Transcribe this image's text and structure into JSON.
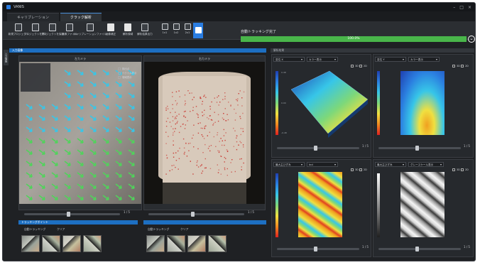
{
  "window": {
    "title": "VANIS"
  },
  "tabs": [
    {
      "label": "キャリブレーション"
    },
    {
      "label": "クラック解析"
    }
  ],
  "toolbar": {
    "buttons": [
      {
        "label": "新規プロジェクト",
        "icon": "new-file-icon"
      },
      {
        "label": "プロジェクトを開く",
        "icon": "open-project-icon"
      },
      {
        "label": "プロジェクトを保存",
        "icon": "save-project-icon"
      },
      {
        "label": "画像ファイル",
        "icon": "image-file-icon"
      },
      {
        "label": "キャリブレーションファイル",
        "icon": "calibration-file-icon"
      },
      {
        "label": "画像補正",
        "icon": "image-correct-icon"
      },
      {
        "label": "解析領域",
        "icon": "analysis-area-icon"
      },
      {
        "label": "解析結果出力",
        "icon": "export-icon"
      }
    ],
    "layout_buttons": [
      {
        "label": "1x1",
        "icon": "layout-1x1-icon"
      },
      {
        "label": "1x2",
        "icon": "layout-1x2-icon"
      },
      {
        "label": "2x1",
        "icon": "layout-2x1-icon"
      },
      {
        "label": "",
        "icon": "layout-2x2-icon"
      }
    ]
  },
  "progress": {
    "label": "自動トラッキング完了",
    "percent_text": "100.0%",
    "value": 1.0
  },
  "sidebar_tab": "入力情報",
  "left_panel": {
    "header": "入力画像",
    "left_view_title": "左カメラ",
    "right_view_title": "右カメラ",
    "overlay_checks": [
      "検出点",
      "ベクトル表示",
      "領域表示"
    ],
    "left_frame": "1 / 5",
    "right_frame": "1 / 5"
  },
  "bottom_left": {
    "header": "トラッキングポイント",
    "title": "自動トラッキング",
    "clear_label": "クリア"
  },
  "bottom_right": {
    "title": "自動トラッキング",
    "clear_label": "クリア"
  },
  "results": {
    "header": "解析結果",
    "plots": [
      {
        "dropdown1": "変位 X",
        "dropdown2": "カラー表示",
        "frame": "1 / 5",
        "mode_3d": "3D",
        "mode_2d": "2D",
        "colorbar_labels": [
          "0.48",
          "0.00",
          "-0.48"
        ]
      },
      {
        "dropdown1": "変位 Y",
        "dropdown2": "カラー表示",
        "frame": "1 / 5",
        "mode_3d": "3D",
        "mode_2d": "2D"
      },
      {
        "dropdown1": "最大主ひずみ",
        "dropdown2": "Ind",
        "frame": "1 / 5",
        "mode_3d": "3D",
        "mode_2d": "2D"
      },
      {
        "dropdown1": "最大主ひずみ",
        "dropdown2": "グレースケール表示",
        "frame": "1 / 5",
        "mode_3d": "3D",
        "mode_2d": "2D"
      }
    ]
  },
  "colors": {
    "accent": "#2a7de1",
    "progress": "#49b64a",
    "panel_header": "#1d6fc2",
    "vector_cyan": "#37c6e8",
    "vector_green": "#4fd45a"
  }
}
